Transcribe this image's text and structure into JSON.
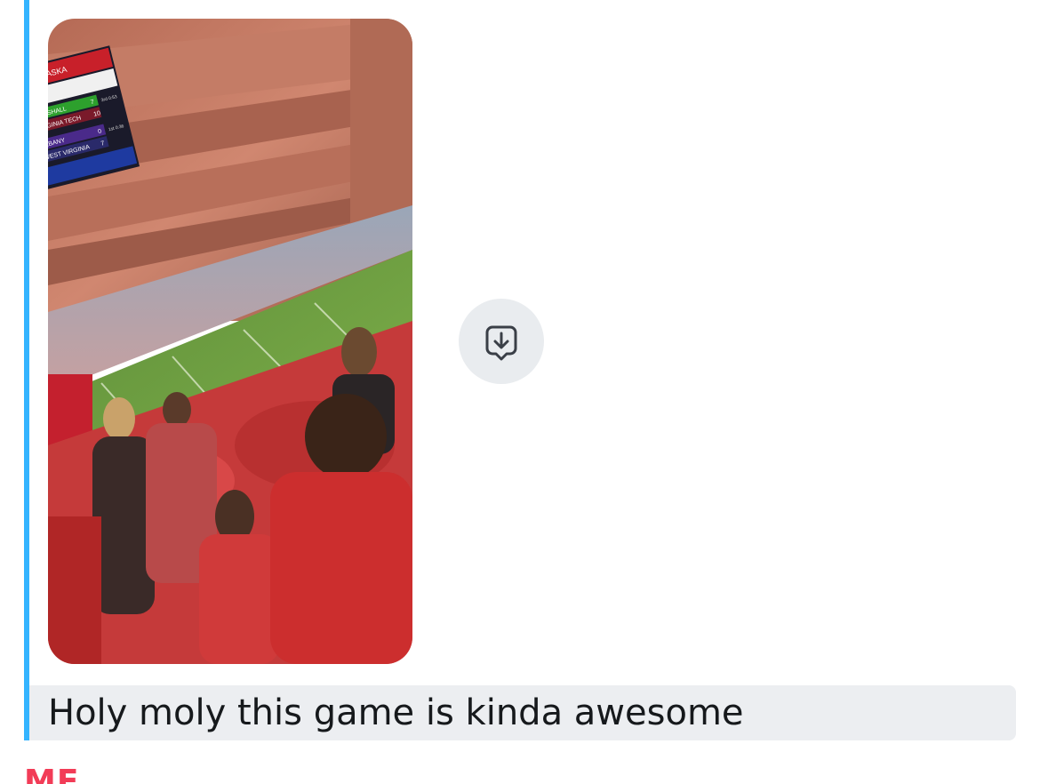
{
  "chat": {
    "snap": {
      "alt": "Photo from upper stands of a football stadium; crowd in red, scoreboard monitor in the corner",
      "scoreboard": {
        "header": "NEBRASKA",
        "rows": [
          {
            "team": "MARSHALL",
            "score": "7",
            "status": "3rd 0:53"
          },
          {
            "team": "VIRGINIA TECH",
            "score": "10",
            "status": ""
          },
          {
            "team": "ALBANY",
            "score": "0",
            "status": "1st 0:36"
          },
          {
            "team": "WEST VIRGINIA",
            "score": "7",
            "status": ""
          }
        ]
      }
    },
    "save_button": {
      "icon": "save-to-memories-icon",
      "accent": "#34b4ff"
    },
    "message": {
      "text": "Holy moly this game is kinda awesome"
    },
    "next_sender": {
      "label": "ME",
      "color": "#f23c57"
    }
  }
}
